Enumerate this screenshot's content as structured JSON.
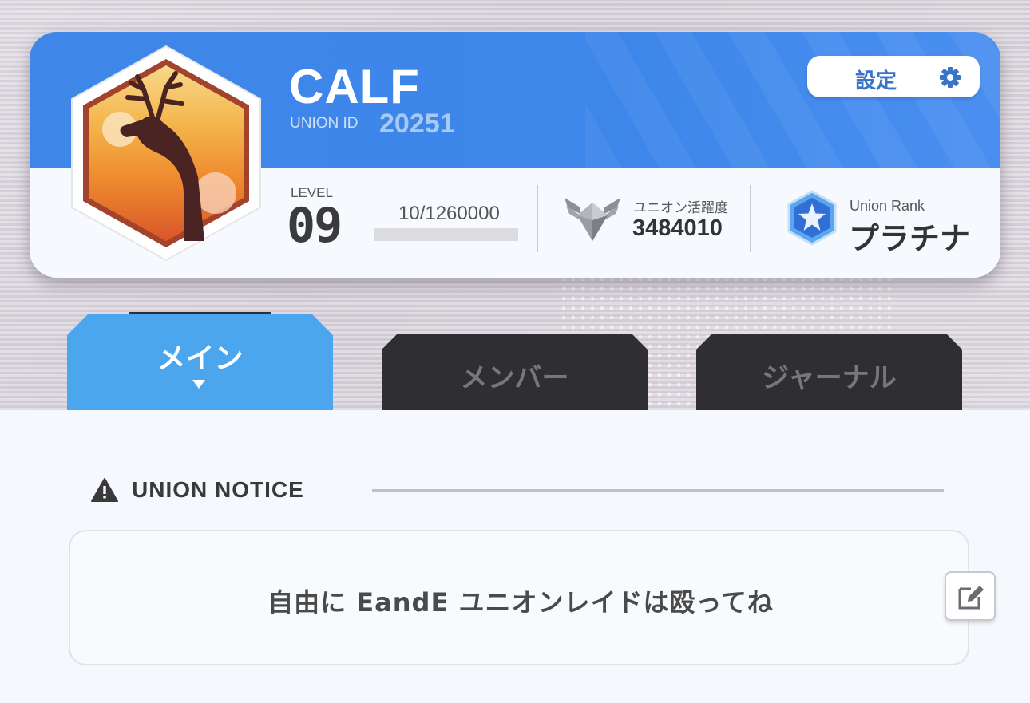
{
  "profile": {
    "name": "CALF",
    "union_id_label": "UNION ID",
    "union_id": "20251",
    "settings_label": "設定",
    "level_label": "LEVEL",
    "level": "09",
    "exp_text": "10/1260000",
    "exp_progress": 7.9e-06,
    "activity_label": "ユニオン活躍度",
    "activity_value": "3484010",
    "rank_label": "Union Rank",
    "rank_value": "プラチナ"
  },
  "tabs": [
    {
      "label": "メイン",
      "active": true
    },
    {
      "label": "メンバー",
      "active": false
    },
    {
      "label": "ジャーナル",
      "active": false
    }
  ],
  "notice": {
    "title": "UNION NOTICE",
    "text": "自由に EandE ユニオンレイドは殴ってね"
  },
  "icons": {
    "emblem": "deer-emblem-icon",
    "settings": "gear-icon",
    "activity": "winged-chevron-icon",
    "rank": "platinum-star-icon",
    "notice": "warning-triangle-icon",
    "edit": "edit-pencil-icon"
  },
  "colors": {
    "header_blue": "#3e86e8",
    "active_tab": "#4ca6ee",
    "inactive_tab": "#2f2f33",
    "settings_text": "#3974c9"
  }
}
